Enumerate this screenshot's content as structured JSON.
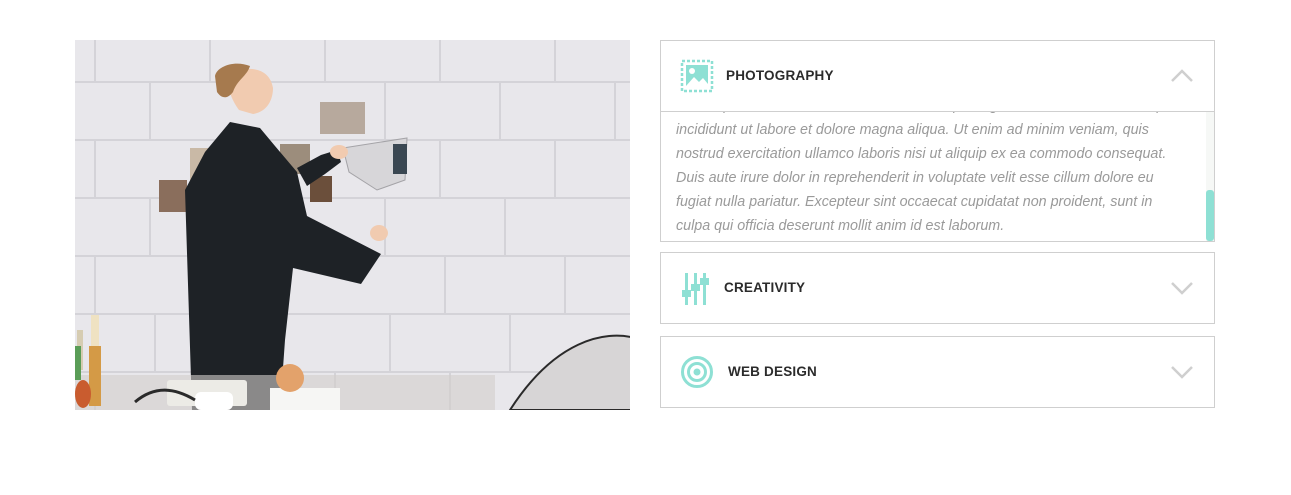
{
  "accordion": {
    "items": [
      {
        "title": "PHOTOGRAPHY",
        "icon": "picture-icon",
        "expanded": true,
        "body": "Lorem ipsum dolor sit amet, consectetur adipiscing elit, sed do eiusmod tempor incididunt ut labore et dolore magna aliqua. Ut enim ad minim veniam, quis nostrud exercitation ullamco laboris nisi ut aliquip ex ea commodo consequat. Duis aute irure dolor in reprehenderit in voluptate velit esse cillum dolore eu fugiat nulla pariatur. Excepteur sint occaecat cupidatat non proident, sunt in culpa qui officia deserunt mollit anim id est laborum."
      },
      {
        "title": "CREATIVITY",
        "icon": "sliders-icon",
        "expanded": false
      },
      {
        "title": "WEB DESIGN",
        "icon": "target-icon",
        "expanded": false
      }
    ],
    "scroll_position": 0.6
  },
  "colors": {
    "accent": "#8ee0d4",
    "border": "#cfcfcf",
    "text": "#2b2b2b",
    "body_text": "#9a9a9a"
  }
}
